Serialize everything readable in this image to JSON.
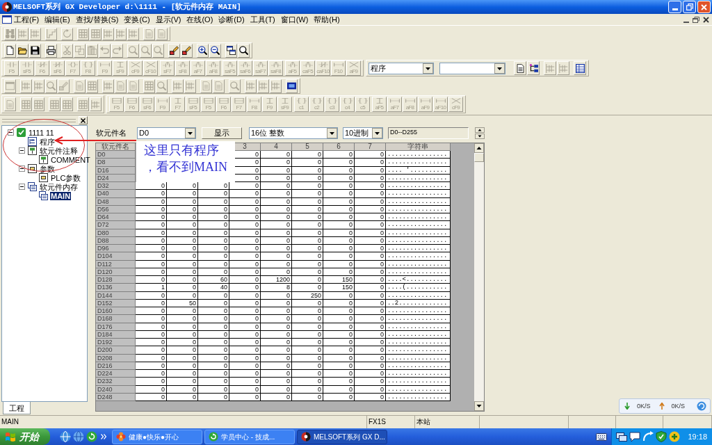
{
  "window": {
    "title": "MELSOFT系列 GX Developer d:\\1111 - [软元件内存 MAIN]"
  },
  "menu": [
    "工程(F)",
    "编辑(E)",
    "查找/替换(S)",
    "变换(C)",
    "显示(V)",
    "在线(O)",
    "诊断(D)",
    "工具(T)",
    "窗口(W)",
    "帮助(H)"
  ],
  "toolbars": [
    {
      "groups": [
        {
          "kind": "buttons",
          "buttons": [
            {
              "disabled": true
            },
            {
              "disabled": true
            },
            {
              "disabled": true
            }
          ]
        },
        {
          "kind": "buttons",
          "buttons": [
            {
              "disabled": true
            }
          ]
        },
        {
          "kind": "buttons",
          "buttons": [
            {
              "disabled": true
            }
          ]
        },
        {
          "kind": "buttons",
          "buttons": [
            {
              "disabled": true
            },
            {
              "disabled": true
            },
            {
              "disabled": true
            },
            {
              "disabled": true
            },
            {
              "disabled": true
            }
          ]
        },
        {
          "kind": "buttons",
          "buttons": [
            {
              "disabled": true
            },
            {
              "disabled": true
            }
          ]
        }
      ]
    },
    {
      "groups": [
        {
          "kind": "buttons",
          "buttons": [
            {
              "disabled": false
            },
            {
              "disabled": false
            },
            {
              "disabled": false
            }
          ]
        },
        {
          "kind": "buttons",
          "buttons": [
            {
              "disabled": false
            }
          ]
        },
        {
          "kind": "buttons",
          "buttons": [
            {
              "disabled": true
            },
            {
              "disabled": true
            },
            {
              "disabled": true
            },
            {
              "disabled": true
            },
            {
              "disabled": true
            }
          ]
        },
        {
          "kind": "buttons",
          "buttons": [
            {
              "disabled": true
            },
            {
              "disabled": true
            },
            {
              "disabled": true
            }
          ]
        },
        {
          "kind": "buttons",
          "buttons": [
            {
              "disabled": false
            },
            {
              "disabled": false
            }
          ]
        },
        {
          "kind": "buttons",
          "buttons": [
            {
              "disabled": false
            },
            {
              "disabled": false
            }
          ]
        },
        {
          "kind": "buttons",
          "buttons": [
            {
              "disabled": false
            },
            {
              "disabled": false
            }
          ]
        }
      ]
    },
    {
      "groups": [
        {
          "kind": "buttons",
          "buttons": [
            {
              "label": "F5",
              "disabled": true
            },
            {
              "label": "sF5",
              "disabled": true
            },
            {
              "label": "F6",
              "disabled": true
            },
            {
              "label": "sF6",
              "disabled": true
            },
            {
              "label": "F7",
              "disabled": true
            },
            {
              "label": "F8",
              "disabled": true
            }
          ]
        },
        {
          "kind": "buttons",
          "buttons": [
            {
              "label": "F9",
              "disabled": true
            },
            {
              "label": "sF9",
              "disabled": true
            },
            {
              "label": "cF9",
              "disabled": true
            },
            {
              "label": "cF10",
              "disabled": true
            }
          ]
        },
        {
          "kind": "buttons",
          "buttons": [
            {
              "label": "sF7",
              "disabled": true
            },
            {
              "label": "sF8",
              "disabled": true
            },
            {
              "label": "aF7",
              "disabled": true
            },
            {
              "label": "aF8",
              "disabled": true
            }
          ]
        },
        {
          "kind": "buttons",
          "buttons": [
            {
              "label": "saF5",
              "disabled": true
            },
            {
              "label": "saF6",
              "disabled": true
            },
            {
              "label": "saF7",
              "disabled": true
            },
            {
              "label": "saF8",
              "disabled": true
            }
          ]
        },
        {
          "kind": "buttons",
          "buttons": [
            {
              "label": "aF5",
              "disabled": true
            },
            {
              "label": "caF5",
              "disabled": true
            },
            {
              "label": "caF10",
              "disabled": true
            },
            {
              "label": "F10",
              "disabled": true
            },
            {
              "label": "aF9",
              "disabled": true
            }
          ]
        },
        {
          "kind": "combos",
          "combos": [
            {
              "kind": "dropdown",
              "value": "程序"
            },
            {
              "kind": "dropdown"
            }
          ]
        },
        {
          "kind": "buttons",
          "buttons": [
            {
              "disabled": false
            },
            {
              "disabled": false
            }
          ]
        },
        {
          "kind": "buttons",
          "buttons": [
            {
              "disabled": true
            },
            {
              "disabled": true
            }
          ]
        },
        {
          "kind": "buttons",
          "buttons": [
            {
              "disabled": false
            }
          ]
        }
      ]
    },
    {
      "groups": [
        {
          "kind": "buttons",
          "buttons": [
            {
              "disabled": true
            }
          ]
        },
        {
          "kind": "buttons",
          "buttons": [
            {
              "disabled": true
            },
            {
              "disabled": true
            },
            {
              "disabled": true
            },
            {
              "disabled": true
            }
          ]
        },
        {
          "kind": "buttons",
          "buttons": [
            {
              "disabled": true
            },
            {
              "disabled": true
            }
          ]
        },
        {
          "kind": "buttons",
          "buttons": [
            {
              "disabled": true
            },
            {
              "disabled": true
            },
            {
              "disabled": true
            }
          ]
        },
        {
          "kind": "buttons",
          "buttons": [
            {
              "disabled": true
            },
            {
              "disabled": true
            }
          ]
        },
        {
          "kind": "buttons",
          "buttons": [
            {
              "disabled": true
            },
            {
              "disabled": true
            }
          ]
        },
        {
          "kind": "buttons",
          "buttons": [
            {
              "disabled": true
            },
            {
              "disabled": true
            }
          ]
        },
        {
          "kind": "buttons",
          "buttons": [
            {
              "disabled": true
            }
          ]
        },
        {
          "kind": "buttons",
          "buttons": [
            {
              "disabled": true
            },
            {
              "disabled": true
            },
            {
              "disabled": true
            }
          ]
        },
        {
          "kind": "buttons",
          "buttons": [
            {
              "disabled": false
            }
          ]
        }
      ]
    },
    {
      "groups": [
        {
          "kind": "buttons",
          "buttons": [
            {
              "disabled": true
            }
          ]
        },
        {
          "kind": "buttons",
          "buttons": [
            {
              "disabled": true
            },
            {
              "disabled": true
            }
          ]
        },
        {
          "kind": "buttons",
          "buttons": [
            {
              "disabled": true
            },
            {
              "disabled": true
            }
          ]
        },
        {
          "kind": "buttons",
          "buttons": [
            {
              "disabled": true
            },
            {
              "disabled": true
            }
          ]
        },
        {
          "kind": "buttons",
          "buttons": [
            {
              "label": "F5",
              "disabled": true
            },
            {
              "label": "F6",
              "disabled": true
            },
            {
              "label": "sF6",
              "disabled": true
            },
            {
              "label": "F9",
              "disabled": true
            },
            {
              "label": "F7",
              "disabled": true
            },
            {
              "label": "sF5",
              "disabled": true
            },
            {
              "label": "F5",
              "disabled": true
            },
            {
              "label": "F6",
              "disabled": true
            },
            {
              "label": "F7",
              "disabled": true
            },
            {
              "label": "F8",
              "disabled": true
            },
            {
              "label": "F9",
              "disabled": true
            },
            {
              "label": "sF9",
              "disabled": true
            }
          ]
        },
        {
          "kind": "buttons",
          "buttons": [
            {
              "label": "c1",
              "disabled": true
            },
            {
              "label": "c2",
              "disabled": true
            },
            {
              "label": "c3",
              "disabled": true
            },
            {
              "label": "c4",
              "disabled": true
            },
            {
              "label": "c5",
              "disabled": true
            }
          ]
        },
        {
          "kind": "buttons",
          "buttons": [
            {
              "label": "aF5",
              "disabled": true
            },
            {
              "label": "aF7",
              "disabled": true
            },
            {
              "label": "aF8",
              "disabled": true
            },
            {
              "label": "aF9",
              "disabled": true
            },
            {
              "label": "aF10",
              "disabled": true
            },
            {
              "label": "cF9",
              "disabled": true
            }
          ]
        }
      ]
    }
  ],
  "project_tree": {
    "items": [
      {
        "label": "1111 11",
        "kind": "project",
        "expanded": true,
        "selected": false,
        "children": [
          {
            "label": "程序",
            "kind": "program",
            "selected": false
          },
          {
            "label": "软元件注释",
            "kind": "comment",
            "expanded": true,
            "selected": false,
            "children": [
              {
                "label": "COMMENT",
                "kind": "comment",
                "selected": false
              }
            ]
          },
          {
            "label": "参数",
            "kind": "parameter",
            "expanded": true,
            "selected": false,
            "children": [
              {
                "label": "PLC参数",
                "kind": "parameter",
                "selected": false
              }
            ]
          },
          {
            "label": "软元件内存",
            "kind": "memory",
            "expanded": true,
            "selected": false,
            "children": [
              {
                "label": "MAIN",
                "kind": "memory",
                "selected": true
              }
            ]
          }
        ]
      }
    ],
    "tabs": [
      {
        "label": "工程",
        "selected": true
      }
    ]
  },
  "device_memory": {
    "label": "软元件名",
    "device": "D0",
    "show_button": "显示",
    "format": "16位 整数",
    "radix": "10进制",
    "range": "D0--D255",
    "name_column": "软元件名",
    "value_columns": [
      "3",
      "4",
      "5",
      "6",
      "7"
    ],
    "text_column": "字符串",
    "rows": [
      {
        "device": "D0",
        "values": [
          "0",
          "0",
          "0",
          "0",
          "0"
        ],
        "text": "................"
      },
      {
        "device": "D8",
        "values": [
          "0",
          "0",
          "0",
          "0",
          "0"
        ],
        "text": "................"
      },
      {
        "device": "D16",
        "values": [
          "0",
          "0",
          "0",
          "0",
          "0"
        ],
        "text": ".... '.........."
      },
      {
        "device": "D24",
        "values": [
          "0",
          "0",
          "0",
          "0",
          "0"
        ],
        "text": "................"
      },
      {
        "device": "D32",
        "values": [
          "0",
          "0",
          "0",
          "0",
          "0",
          "0",
          "0",
          "0"
        ],
        "text": "................"
      },
      {
        "device": "D40",
        "values": [
          "0",
          "0",
          "0",
          "0",
          "0",
          "0",
          "0",
          "0"
        ],
        "text": "................"
      },
      {
        "device": "D48",
        "values": [
          "0",
          "0",
          "0",
          "0",
          "0",
          "0",
          "0",
          "0"
        ],
        "text": "................"
      },
      {
        "device": "D56",
        "values": [
          "0",
          "0",
          "0",
          "0",
          "0",
          "0",
          "0",
          "0"
        ],
        "text": "................"
      },
      {
        "device": "D64",
        "values": [
          "0",
          "0",
          "0",
          "0",
          "0",
          "0",
          "0",
          "0"
        ],
        "text": "................"
      },
      {
        "device": "D72",
        "values": [
          "0",
          "0",
          "0",
          "0",
          "0",
          "0",
          "0",
          "0"
        ],
        "text": "................"
      },
      {
        "device": "D80",
        "values": [
          "0",
          "0",
          "0",
          "0",
          "0",
          "0",
          "0",
          "0"
        ],
        "text": "................"
      },
      {
        "device": "D88",
        "values": [
          "0",
          "0",
          "0",
          "0",
          "0",
          "0",
          "0",
          "0"
        ],
        "text": "................"
      },
      {
        "device": "D96",
        "values": [
          "0",
          "0",
          "0",
          "0",
          "0",
          "0",
          "0",
          "0"
        ],
        "text": "................"
      },
      {
        "device": "D104",
        "values": [
          "0",
          "0",
          "0",
          "0",
          "0",
          "0",
          "0",
          "0"
        ],
        "text": "................"
      },
      {
        "device": "D112",
        "values": [
          "0",
          "0",
          "0",
          "0",
          "0",
          "0",
          "0",
          "0"
        ],
        "text": "................"
      },
      {
        "device": "D120",
        "values": [
          "0",
          "0",
          "0",
          "0",
          "0",
          "0",
          "0",
          "0"
        ],
        "text": "................"
      },
      {
        "device": "D128",
        "values": [
          "0",
          "0",
          "60",
          "0",
          "1200",
          "0",
          "150",
          "0"
        ],
        "text": "....<..........."
      },
      {
        "device": "D136",
        "values": [
          "1",
          "0",
          "40",
          "0",
          "8",
          "0",
          "150",
          "0"
        ],
        "text": "....(..........."
      },
      {
        "device": "D144",
        "values": [
          "0",
          "0",
          "0",
          "0",
          "0",
          "250",
          "0",
          "0"
        ],
        "text": "................"
      },
      {
        "device": "D152",
        "values": [
          "0",
          "50",
          "0",
          "0",
          "0",
          "0",
          "0",
          "0"
        ],
        "text": "..2............."
      },
      {
        "device": "D160",
        "values": [
          "0",
          "0",
          "0",
          "0",
          "0",
          "0",
          "0",
          "0"
        ],
        "text": "................"
      },
      {
        "device": "D168",
        "values": [
          "0",
          "0",
          "0",
          "0",
          "0",
          "0",
          "0",
          "0"
        ],
        "text": "................"
      },
      {
        "device": "D176",
        "values": [
          "0",
          "0",
          "0",
          "0",
          "0",
          "0",
          "0",
          "0"
        ],
        "text": "................"
      },
      {
        "device": "D184",
        "values": [
          "0",
          "0",
          "0",
          "0",
          "0",
          "0",
          "0",
          "0"
        ],
        "text": "................"
      },
      {
        "device": "D192",
        "values": [
          "0",
          "0",
          "0",
          "0",
          "0",
          "0",
          "0",
          "0"
        ],
        "text": "................"
      },
      {
        "device": "D200",
        "values": [
          "0",
          "0",
          "0",
          "0",
          "0",
          "0",
          "0",
          "0"
        ],
        "text": "................"
      },
      {
        "device": "D208",
        "values": [
          "0",
          "0",
          "0",
          "0",
          "0",
          "0",
          "0",
          "0"
        ],
        "text": "................"
      },
      {
        "device": "D216",
        "values": [
          "0",
          "0",
          "0",
          "0",
          "0",
          "0",
          "0",
          "0"
        ],
        "text": "................"
      },
      {
        "device": "D224",
        "values": [
          "0",
          "0",
          "0",
          "0",
          "0",
          "0",
          "0",
          "0"
        ],
        "text": "................"
      },
      {
        "device": "D232",
        "values": [
          "0",
          "0",
          "0",
          "0",
          "0",
          "0",
          "0",
          "0"
        ],
        "text": "................"
      },
      {
        "device": "D240",
        "values": [
          "0",
          "0",
          "0",
          "0",
          "0",
          "0",
          "0",
          "0"
        ],
        "text": "................"
      },
      {
        "device": "D248",
        "values": [
          "0",
          "0",
          "0",
          "0",
          "0",
          "0",
          "0",
          "0"
        ],
        "text": "................"
      }
    ]
  },
  "annotation": {
    "lines": [
      "这里只有程序",
      "，看不到MAIN"
    ]
  },
  "net_monitor": {
    "download": "0K/S",
    "upload": "0K/S"
  },
  "status_bar": {
    "panels": [
      "MAIN",
      "FX1S",
      "本站"
    ]
  },
  "taskbar": {
    "start": "开始",
    "tasks": [
      {
        "label": "健康●快乐●开心",
        "selected": false
      },
      {
        "label": "学员中心 - 技成...",
        "selected": false
      },
      {
        "label": "MELSOFT系列 GX D...",
        "selected": true
      }
    ],
    "clock": "19:18"
  }
}
